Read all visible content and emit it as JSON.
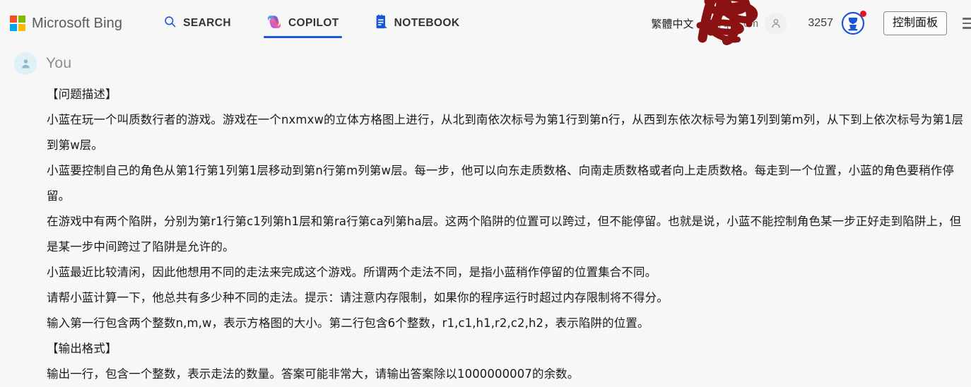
{
  "header": {
    "brand": {
      "name": "Microsoft Bing",
      "logo_icon": "microsoft-logo-icon"
    },
    "nav": [
      {
        "label": "SEARCH",
        "icon": "search-icon",
        "active": false
      },
      {
        "label": "COPILOT",
        "icon": "copilot-icon",
        "active": true
      },
      {
        "label": "NOTEBOOK",
        "icon": "notebook-icon",
        "active": false
      }
    ],
    "language": "繁體中文",
    "account": {
      "email": "@qq.com",
      "redaction": "red-scribble-overlay",
      "avatar_icon": "person-icon"
    },
    "points": "3257",
    "reward_icon": "rewards-medal-icon",
    "reward_badge_color": "#e81123",
    "control_panel_label": "控制面板",
    "menu_icon": "hamburger-menu-icon",
    "accent_color": "#1a56db"
  },
  "conversation": {
    "speaker": {
      "name": "You",
      "avatar_icon": "user-avatar-icon"
    },
    "paragraphs": [
      "【问题描述】",
      "小蓝在玩一个叫质数行者的游戏。游戏在一个nxmxw的立体方格图上进行，从北到南依次标号为第1行到第n行，从西到东依次标号为第1列到第m列，从下到上依次标号为第1层到第w层。",
      "小蓝要控制自己的角色从第1行第1列第1层移动到第n行第m列第w层。每一步，他可以向东走质数格、向南走质数格或者向上走质数格。每走到一个位置，小蓝的角色要稍作停留。",
      "在游戏中有两个陷阱，分别为第r1行第c1列第h1层和第ra行第ca列第ha层。这两个陷阱的位置可以跨过，但不能停留。也就是说，小蓝不能控制角色某一步正好走到陷阱上，但是某一步中间跨过了陷阱是允许的。",
      "小蓝最近比较清闲，因此他想用不同的走法来完成这个游戏。所谓两个走法不同，是指小蓝稍作停留的位置集合不同。",
      "请帮小蓝计算一下，他总共有多少种不同的走法。提示：请注意内存限制，如果你的程序运行时超过内存限制将不得分。",
      "输入第一行包含两个整数n,m,w，表示方格图的大小。第二行包含6个整数，r1,c1,h1,r2,c2,h2，表示陷阱的位置。",
      "【输出格式】",
      "输出一行，包含一个整数，表示走法的数量。答案可能非常大，请输出答案除以1000000007的余数。"
    ]
  }
}
